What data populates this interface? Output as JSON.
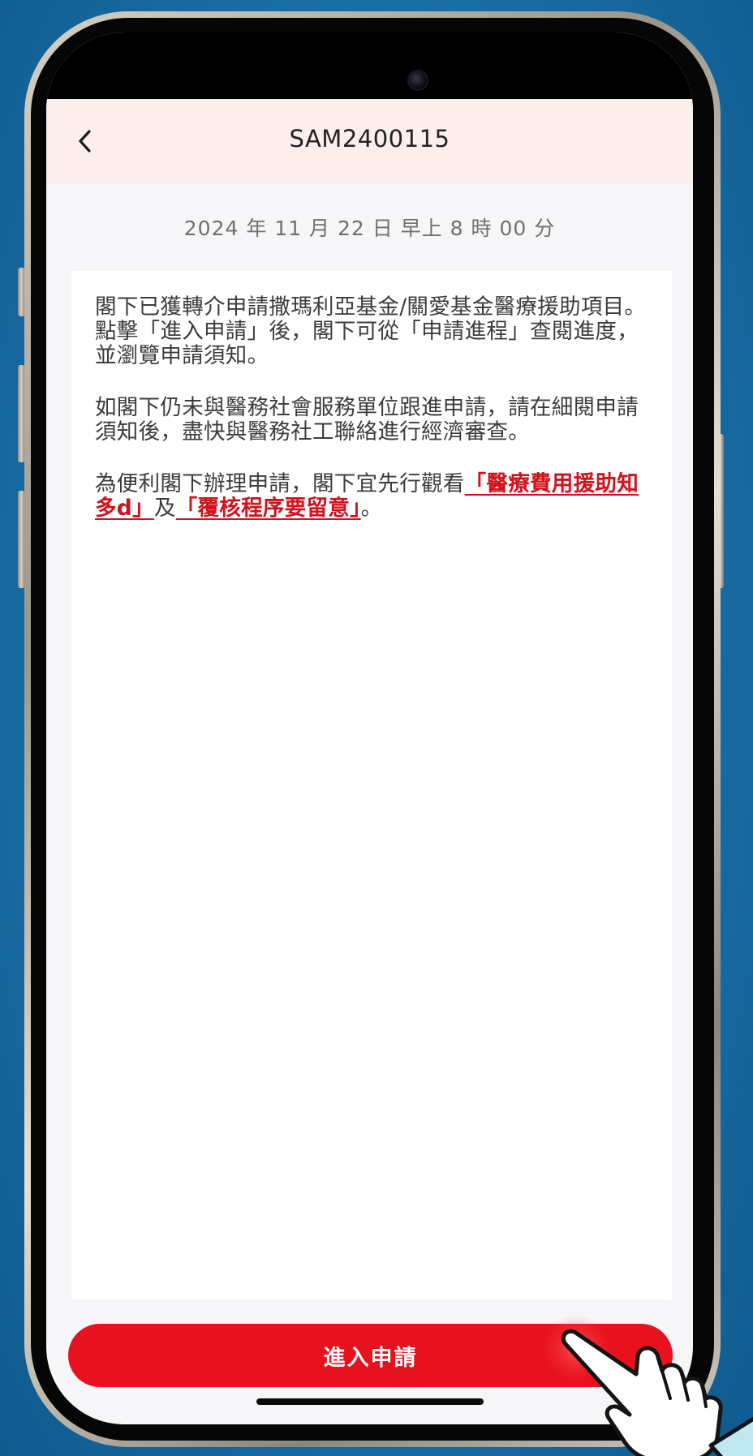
{
  "header": {
    "title": "SAM2400115",
    "back_icon": "chevron-left-icon"
  },
  "datetime": "2024 年 11 月 22 日  早上 8 時 00 分",
  "message": {
    "paragraph1": "閣下已獲轉介申請撒瑪利亞基金/關愛基金醫療援助項目。點擊「進入申請」後，閣下可從「申請進程」查閱進度，並瀏覽申請須知。",
    "paragraph2": "如閣下仍未與醫務社會服務單位跟進申請，請在細閱申請須知後，盡快與醫務社工聯絡進行經濟審查。",
    "paragraph3_prefix": "為便利閣下辦理申請，閣下宜先行觀看",
    "link1": "「醫療費用援助知多d」",
    "paragraph3_middle": "及",
    "link2": "「覆核程序要留意」",
    "paragraph3_suffix": "。"
  },
  "cta": {
    "label": "進入申請"
  },
  "colors": {
    "accent": "#e8121e",
    "link": "#d1121d",
    "navbar_bg": "#fceeed",
    "page_bg": "#f6f5f7"
  }
}
